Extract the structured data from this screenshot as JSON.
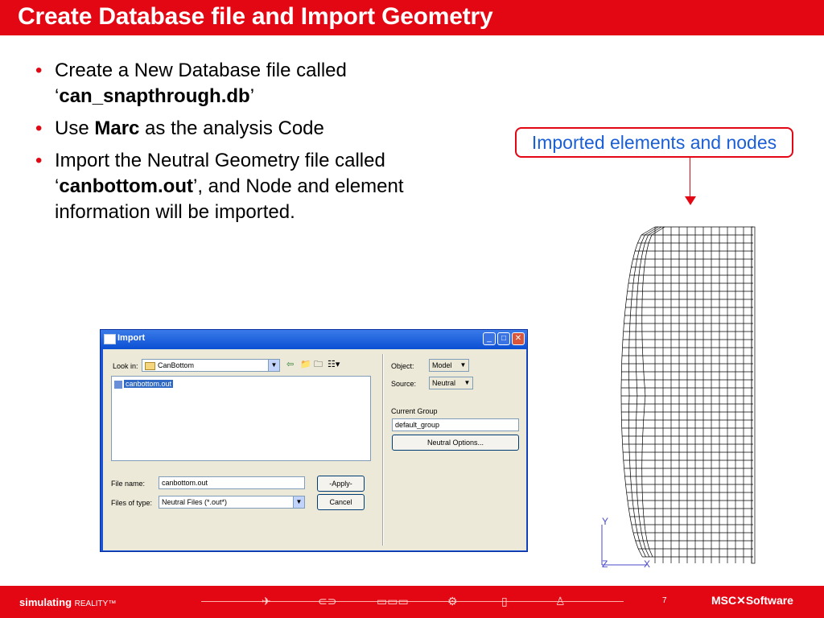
{
  "slide": {
    "title": "Create Database file and Import Geometry",
    "bullets": [
      {
        "pre": "Create a New Database file called",
        "bold_prefix": "‘",
        "bold": "can_snapthrough.db",
        "post": "’"
      },
      {
        "pre": "Use ",
        "bold": "Marc",
        "post": " as the analysis Code"
      },
      {
        "pre": "Import the Neutral Geometry file called",
        "bold_prefix": "‘",
        "bold": "canbottom.out",
        "post": "’, and Node and element information will be imported."
      }
    ],
    "callout": "Imported elements and nodes",
    "axis_labels": {
      "y": "Y",
      "z": "Z",
      "x": "X"
    }
  },
  "dialog": {
    "title": "Import",
    "look_in_label": "Look in:",
    "look_in_value": "CanBottom",
    "files": [
      "canbottom.out"
    ],
    "file_name_label": "File name:",
    "file_name_value": "canbottom.out",
    "files_of_type_label": "Files of type:",
    "files_of_type_value": "Neutral Files (*.out*)",
    "apply_label": "-Apply-",
    "cancel_label": "Cancel",
    "object_label": "Object:",
    "object_value": "Model",
    "source_label": "Source:",
    "source_value": "Neutral",
    "current_group_label": "Current Group",
    "current_group_value": "default_group",
    "neutral_options_label": "Neutral Options..."
  },
  "footer": {
    "tagline": "simulating",
    "tagline_reality": "REALITY™",
    "page_number": "7",
    "logo": "MSC✕Software"
  },
  "colors": {
    "accent": "#e30613",
    "callout_text": "#1a5fd6",
    "dialog_frame": "#1b55d6"
  }
}
